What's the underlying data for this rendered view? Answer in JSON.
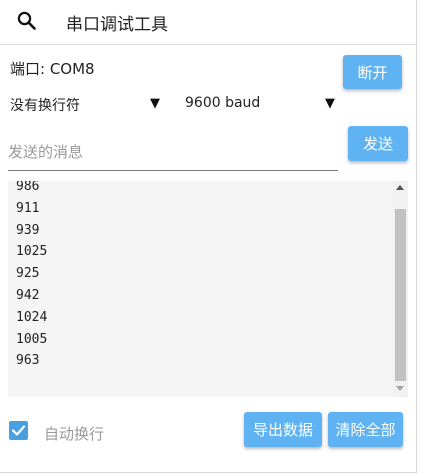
{
  "header": {
    "title": "串口调试工具",
    "search_icon": "search-icon"
  },
  "connection": {
    "port_label": "端口:  COM8",
    "disconnect_label": "断开"
  },
  "settings": {
    "line_ending": "没有换行符",
    "baud_rate": "9600 baud"
  },
  "message": {
    "placeholder": "发送的消息",
    "value": "",
    "send_label": "发送"
  },
  "log": {
    "lines": [
      "986",
      "911",
      "939",
      "1025",
      "925",
      "942",
      "1024",
      "1005",
      "963"
    ]
  },
  "footer": {
    "auto_wrap_label": "自动换行",
    "auto_wrap_checked": true,
    "export_label": "导出数据",
    "clear_label": "清除全部"
  },
  "colors": {
    "accent": "#5fb3f2",
    "checkbox": "#4a9fe0"
  }
}
